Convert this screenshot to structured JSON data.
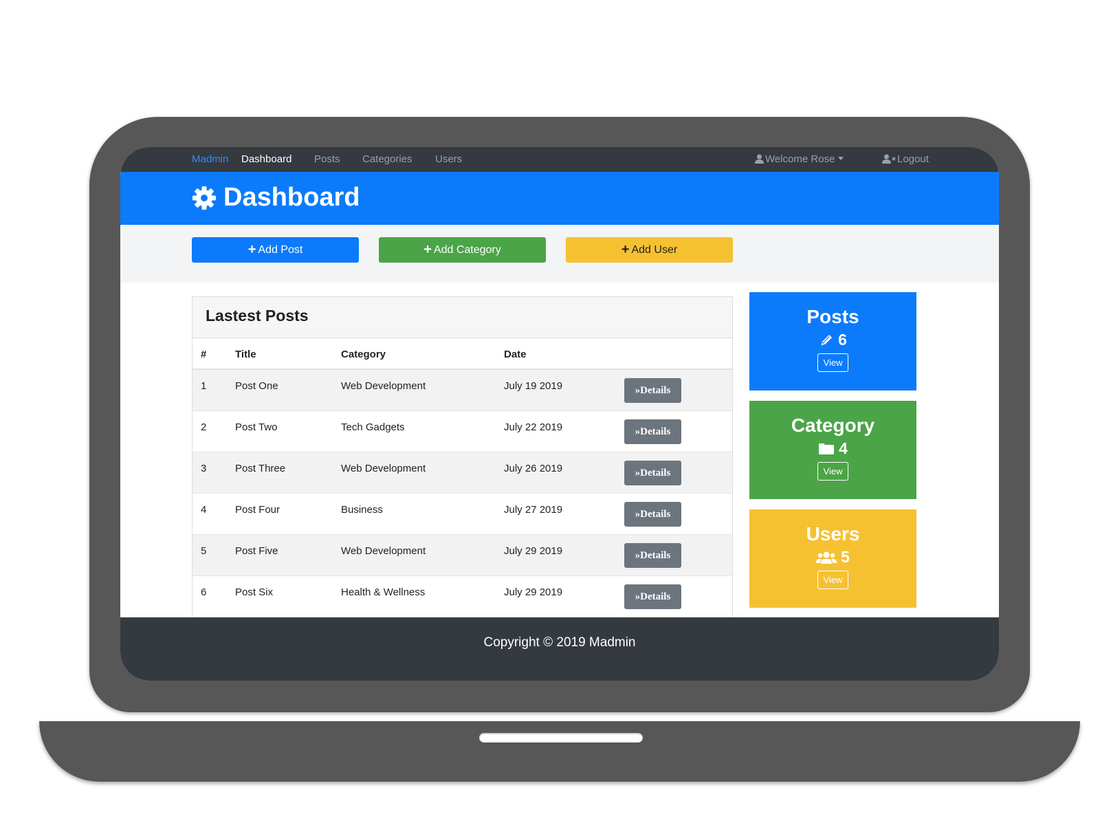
{
  "navbar": {
    "brand": "Madmin",
    "links": [
      "Dashboard",
      "Posts",
      "Categories",
      "Users"
    ],
    "welcome": "Welcome Rose",
    "logout": "Logout"
  },
  "header": {
    "title": "Dashboard",
    "icon": "gear-icon"
  },
  "actions": {
    "add_post": "Add Post",
    "add_category": "Add Category",
    "add_user": "Add User"
  },
  "posts_panel": {
    "title": "Lastest Posts",
    "columns": [
      "#",
      "Title",
      "Category",
      "Date"
    ],
    "details_label": "»Details",
    "rows": [
      {
        "num": "1",
        "title": "Post One",
        "category": "Web Development",
        "date": "July 19 2019"
      },
      {
        "num": "2",
        "title": "Post Two",
        "category": "Tech Gadgets",
        "date": "July 22 2019"
      },
      {
        "num": "3",
        "title": "Post Three",
        "category": "Web Development",
        "date": "July 26 2019"
      },
      {
        "num": "4",
        "title": "Post Four",
        "category": "Business",
        "date": "July 27 2019"
      },
      {
        "num": "5",
        "title": "Post Five",
        "category": "Web Development",
        "date": "July 29 2019"
      },
      {
        "num": "6",
        "title": "Post Six",
        "category": "Health & Wellness",
        "date": "July 29 2019"
      }
    ]
  },
  "cards": {
    "posts": {
      "title": "Posts",
      "count": "6",
      "view": "View",
      "icon": "pencil-icon",
      "color": "#0b7bfb"
    },
    "category": {
      "title": "Category",
      "count": "4",
      "view": "View",
      "icon": "folder-icon",
      "color": "#4ba447"
    },
    "users": {
      "title": "Users",
      "count": "5",
      "view": "View",
      "icon": "users-icon",
      "color": "#f6c131"
    }
  },
  "footer": {
    "text": "Copyright © 2019 Madmin"
  }
}
